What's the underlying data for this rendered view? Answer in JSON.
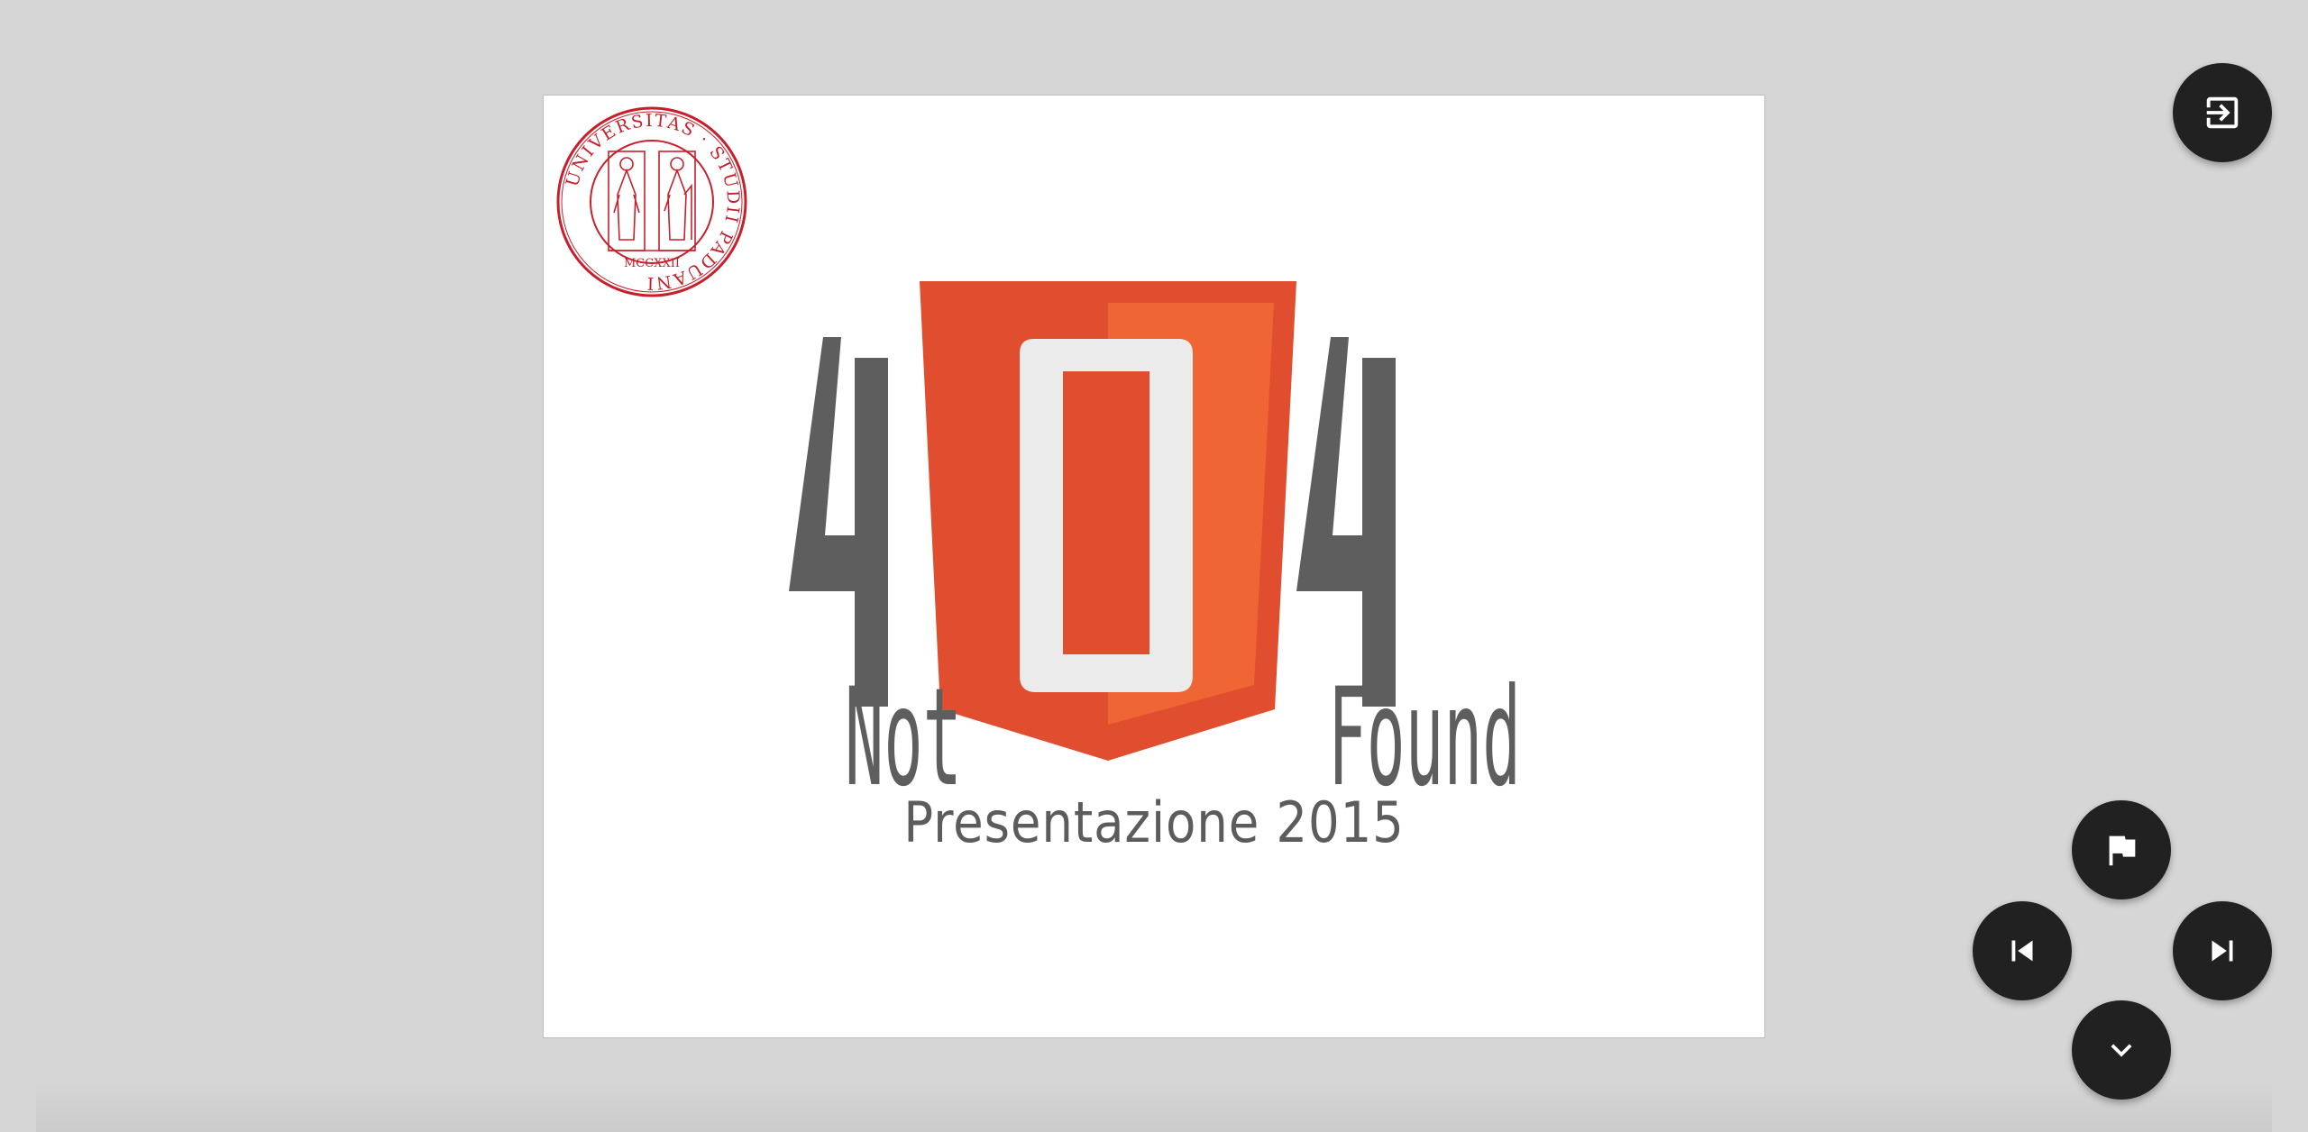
{
  "slide": {
    "title": "Presentazione 2015",
    "logo": {
      "big_text": "404",
      "left_word": "Not",
      "right_word": "Found",
      "colors": {
        "gray": "#5e5e5e",
        "shield_dark": "#e04e2f",
        "shield_light": "#ef6533",
        "zero": "#ebebeb"
      }
    },
    "seal": {
      "ring_text": "UNIVERSITAS · STUDII PADUANI",
      "year_roman": "MCCXXII",
      "color": "#c8202b"
    }
  },
  "controls": {
    "exit": {
      "icon": "exit-presentation-icon"
    },
    "first": {
      "icon": "flag-icon"
    },
    "previous": {
      "icon": "skip-previous-icon"
    },
    "next": {
      "icon": "skip-next-icon"
    },
    "menu": {
      "icon": "chevron-down-icon"
    }
  }
}
